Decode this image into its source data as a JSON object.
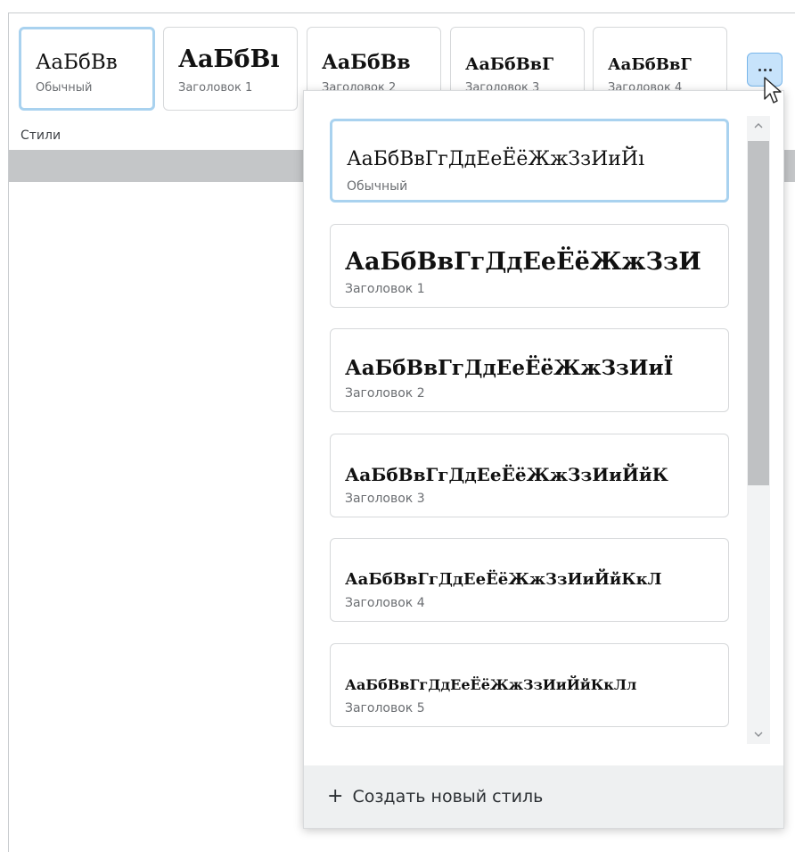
{
  "ribbon": {
    "section_label": "Стили",
    "styles": [
      {
        "sample": "АаБбВв",
        "caption": "Обычный",
        "selected": true
      },
      {
        "sample": "АаБбВı",
        "caption": "Заголовок 1"
      },
      {
        "sample": "АаБбВв",
        "caption": "Заголовок 2"
      },
      {
        "sample": "АаБбВвГ",
        "caption": "Заголовок 3"
      },
      {
        "sample": "АаБбВвГ",
        "caption": "Заголовок 4"
      }
    ],
    "more_button_icon": "more-horizontal-icon"
  },
  "dropdown": {
    "items": [
      {
        "sample": "АаБбВвГгДдЕеЁёЖжЗзИиЙı",
        "caption": "Обычный",
        "selected": true
      },
      {
        "sample": "АаБбВвГгДдЕеЁёЖжЗзИ",
        "caption": "Заголовок 1"
      },
      {
        "sample": "АаБбВвГгДдЕеЁёЖжЗзИиЇ",
        "caption": "Заголовок 2"
      },
      {
        "sample": "АаБбВвГгДдЕеЁёЖжЗзИиЙйК",
        "caption": "Заголовок 3"
      },
      {
        "sample": "АаБбВвГгДдЕеЁёЖжЗзИиЙйКкЛ",
        "caption": "Заголовок 4"
      },
      {
        "sample": "АаБбВвГгДдЕеЁёЖжЗзИиЙйКкЛл",
        "caption": "Заголовок 5"
      }
    ],
    "footer": {
      "icon": "plus-icon",
      "label": "Создать новый стиль"
    }
  },
  "colors": {
    "selection_border": "#a9d2ef",
    "button_active_bg": "#c7e3fb",
    "footer_bg": "#eef0f1"
  }
}
